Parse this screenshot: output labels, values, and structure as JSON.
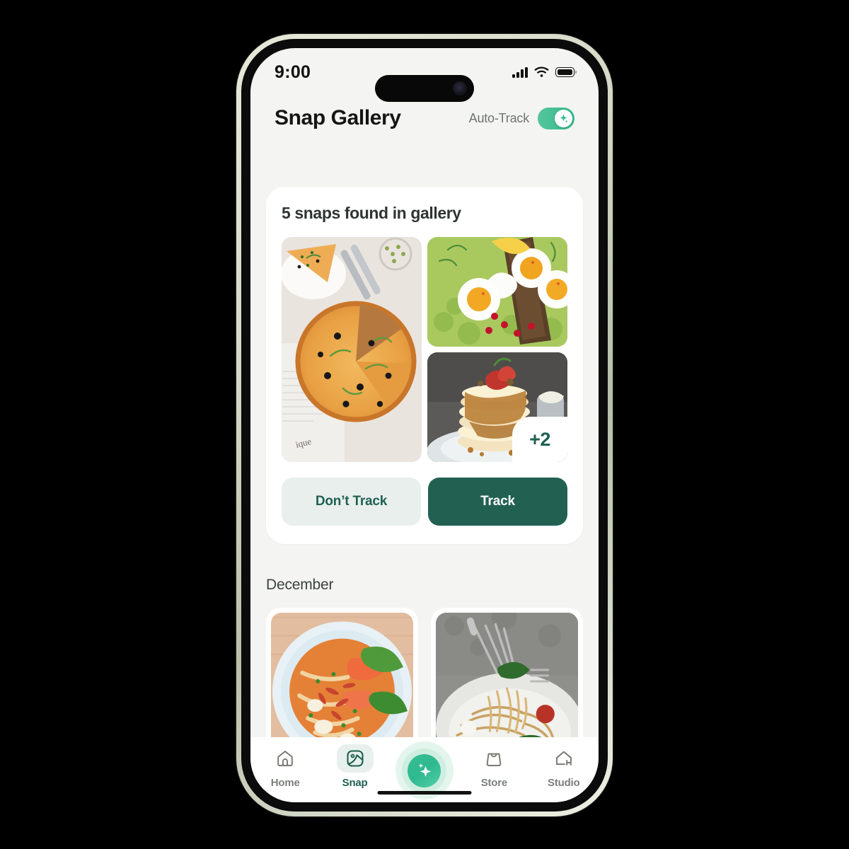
{
  "statusbar": {
    "time": "9:00",
    "signal_icon": "cellular-signal-icon",
    "wifi_icon": "wifi-icon",
    "battery_icon": "battery-icon"
  },
  "header": {
    "title": "Snap Gallery",
    "auto_track_label": "Auto-Track",
    "auto_track_on": true,
    "toggle_knob_icon": "sparkle-icon"
  },
  "snap_card": {
    "title": "5 snaps found in gallery",
    "photos": [
      {
        "name": "pizza-photo",
        "alt": "Pizza on wooden board"
      },
      {
        "name": "avocado-toast-photo",
        "alt": "Avocado toast with eggs"
      },
      {
        "name": "pancakes-photo",
        "alt": "Pancake stack with syrup"
      }
    ],
    "more_count": "+2",
    "dont_track_label": "Don’t Track",
    "track_label": "Track"
  },
  "month_section": {
    "title": "December",
    "photos": [
      {
        "name": "noodle-soup-photo",
        "alt": "Spicy seafood noodle soup"
      },
      {
        "name": "spaghetti-photo",
        "alt": "Spaghetti on a fork"
      }
    ]
  },
  "tabbar": {
    "items": [
      {
        "label": "Home",
        "icon": "home-icon",
        "active": false
      },
      {
        "label": "Snap",
        "icon": "image-icon",
        "active": true
      },
      {
        "label": "Store",
        "icon": "bag-icon",
        "active": false
      },
      {
        "label": "Studio",
        "icon": "studio-house-icon",
        "active": false
      }
    ],
    "fab_icon": "sparkle-icon"
  },
  "colors": {
    "accent_dark": "#226152",
    "accent_green": "#35b98d",
    "ghost_bg": "#e9efec",
    "screen_bg": "#f4f4f2",
    "card_bg": "#ffffff"
  }
}
